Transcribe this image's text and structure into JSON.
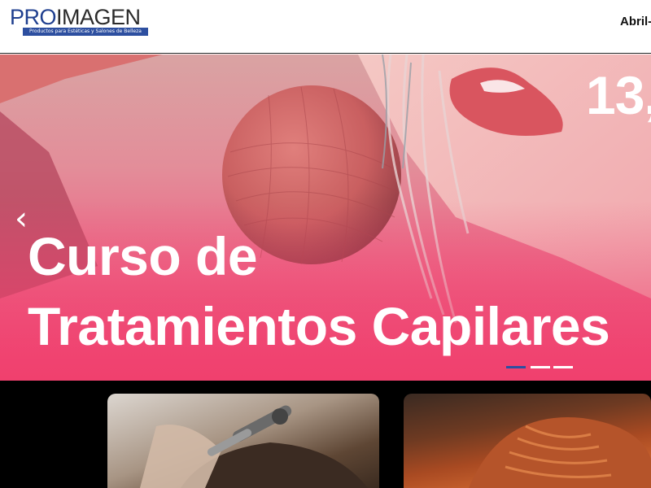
{
  "header": {
    "logo": {
      "pro": "PRO",
      "imagen": "IMAGEN",
      "tagline": "Productos para Estéticas y Salones de Belleza"
    },
    "nav": {
      "item": "Abril-"
    }
  },
  "hero": {
    "date": "13,",
    "title_line1": "Curso de",
    "title_line2": "Tratamientos Capilares",
    "prev_arrow": "‹",
    "slides_total": 3,
    "active_slide": 1
  },
  "colors": {
    "brand_blue": "#2d4fa0",
    "hero_pink": "#f0406e",
    "text_white": "#ffffff"
  },
  "cards": [
    {
      "name": "hairstyling-curling-card"
    },
    {
      "name": "braid-hairstyle-card"
    }
  ]
}
